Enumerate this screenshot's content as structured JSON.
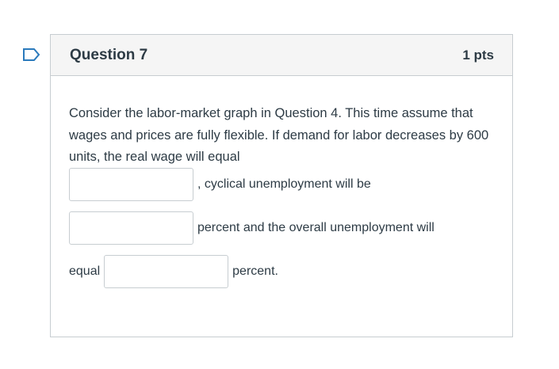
{
  "question": {
    "title": "Question 7",
    "points": "1 pts",
    "text": "Consider the labor-market graph in Question 4. This time assume that wages and prices are fully flexible. If demand for labor decreases by 600 units, the real wage will equal",
    "blanks": [
      {
        "before": "",
        "value": "",
        "after": ", cyclical unemployment will be"
      },
      {
        "before": "",
        "value": "",
        "after": "percent and the overall unemployment will"
      },
      {
        "before": "equal",
        "value": "",
        "after": "percent."
      }
    ]
  },
  "colors": {
    "flag_outline": "#2b7abc",
    "header_background": "#f5f5f5",
    "border": "#c7cdd1",
    "text": "#2d3b45"
  },
  "icons": {
    "flag": "bookmark-flag-icon"
  }
}
